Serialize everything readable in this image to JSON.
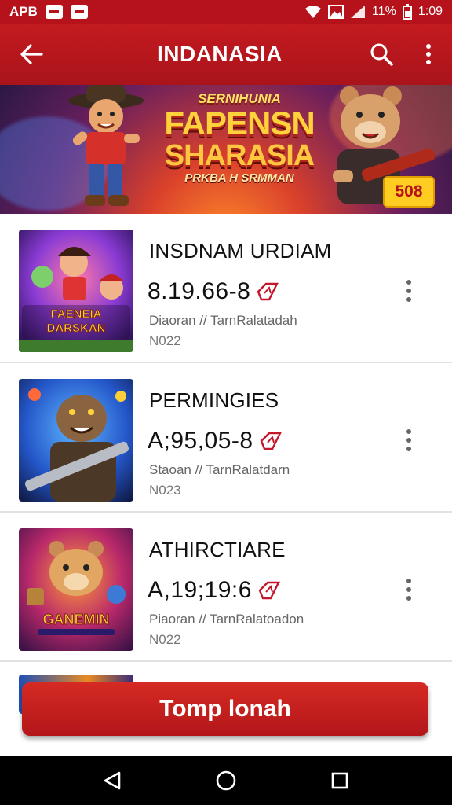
{
  "status_bar": {
    "app_label": "APB",
    "battery_percent": "11%",
    "time": "1:09"
  },
  "app_bar": {
    "title": "INDANASIA"
  },
  "banner": {
    "top_text": "SERNIHUNIA",
    "main_line1": "FAPENSN",
    "main_line2": "SHARASIA",
    "sub_text": "PRKBA H SRMMAN",
    "badge": "508"
  },
  "items": [
    {
      "name": "INSDNAM URDIAM",
      "value": "8.19.66-8",
      "meta": "Diaoran // TarnRalatadah",
      "code": "N022",
      "thumb_label_1": "FAENEIA",
      "thumb_label_2": "DARSKAN"
    },
    {
      "name": "PERMINGIES",
      "value": "A;95,05-8",
      "meta": "Staoan // TarnRalatdarn",
      "code": "N023"
    },
    {
      "name": "ATHIRCTIARE",
      "value": "A,19;19:6",
      "meta": "Piaoran // TarnRalatoadon",
      "code": "N022",
      "thumb_label_1": "GANEMIN"
    }
  ],
  "cta": {
    "label": "Tomp lonah"
  },
  "colors": {
    "primary": "#b5121b",
    "accent": "#ffcc22",
    "text": "#111111",
    "muted": "#666666"
  },
  "icons": {
    "back": "arrow-left-icon",
    "search": "search-icon",
    "more": "more-vertical-icon",
    "coin": "coin-icon",
    "nav_back": "triangle-back-icon",
    "nav_home": "circle-home-icon",
    "nav_recent": "square-recent-icon"
  }
}
